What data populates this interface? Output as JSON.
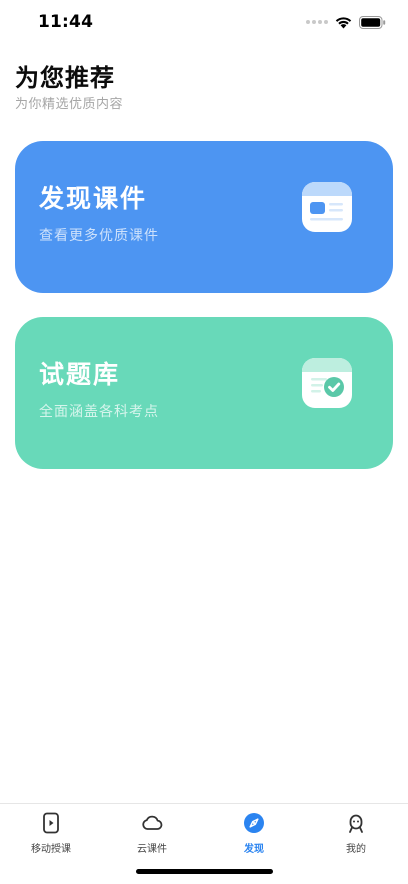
{
  "status_bar": {
    "time": "11:44"
  },
  "header": {
    "title": "为您推荐",
    "subtitle": "为你精选优质内容"
  },
  "cards": [
    {
      "title": "发现课件",
      "description": "查看更多优质课件",
      "icon": "courseware-doc-icon",
      "color": "#4d95f2"
    },
    {
      "title": "试题库",
      "description": "全面涵盖各科考点",
      "icon": "question-bank-check-icon",
      "color": "#68d9b9"
    }
  ],
  "tab_bar": {
    "items": [
      {
        "label": "移动授课",
        "icon": "mobile-teaching-icon",
        "active": false
      },
      {
        "label": "云课件",
        "icon": "cloud-icon",
        "active": false
      },
      {
        "label": "发现",
        "icon": "compass-icon",
        "active": true
      },
      {
        "label": "我的",
        "icon": "profile-icon",
        "active": false
      }
    ],
    "active_color": "#2b84f0"
  }
}
